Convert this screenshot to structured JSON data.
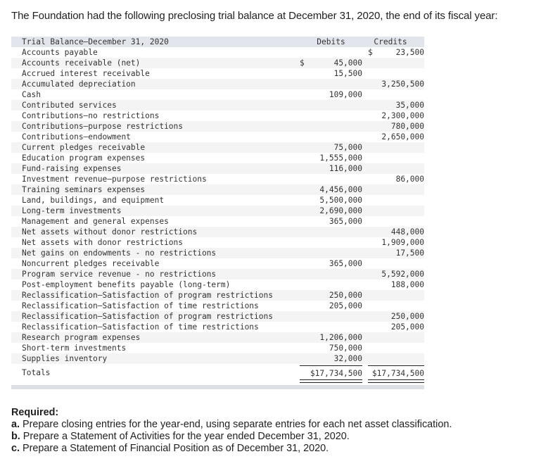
{
  "intro": "The Foundation had the following preclosing trial balance at December 31, 2020, the end of its fiscal year:",
  "table": {
    "title": "Trial Balance—December 31, 2020",
    "debits_header": "Debits",
    "credits_header": "Credits",
    "rows": [
      {
        "name": "Accounts payable",
        "dsign": "",
        "debit": "",
        "csign": "$",
        "credit": "23,500"
      },
      {
        "name": "Accounts receivable (net)",
        "dsign": "$",
        "debit": "45,000",
        "csign": "",
        "credit": ""
      },
      {
        "name": "Accrued interest receivable",
        "dsign": "",
        "debit": "15,500",
        "csign": "",
        "credit": ""
      },
      {
        "name": "Accumulated depreciation",
        "dsign": "",
        "debit": "",
        "csign": "",
        "credit": "3,250,500"
      },
      {
        "name": "Cash",
        "dsign": "",
        "debit": "109,000",
        "csign": "",
        "credit": ""
      },
      {
        "name": "Contributed services",
        "dsign": "",
        "debit": "",
        "csign": "",
        "credit": "35,000"
      },
      {
        "name": "Contributions—no restrictions",
        "dsign": "",
        "debit": "",
        "csign": "",
        "credit": "2,300,000"
      },
      {
        "name": "Contributions—purpose restrictions",
        "dsign": "",
        "debit": "",
        "csign": "",
        "credit": "780,000"
      },
      {
        "name": "Contributions—endowment",
        "dsign": "",
        "debit": "",
        "csign": "",
        "credit": "2,650,000"
      },
      {
        "name": "Current pledges receivable",
        "dsign": "",
        "debit": "75,000",
        "csign": "",
        "credit": ""
      },
      {
        "name": "Education program expenses",
        "dsign": "",
        "debit": "1,555,000",
        "csign": "",
        "credit": ""
      },
      {
        "name": "Fund-raising expenses",
        "dsign": "",
        "debit": "116,000",
        "csign": "",
        "credit": ""
      },
      {
        "name": "Investment revenue—purpose restrictions",
        "dsign": "",
        "debit": "",
        "csign": "",
        "credit": "86,000"
      },
      {
        "name": "Training seminars expenses",
        "dsign": "",
        "debit": "4,456,000",
        "csign": "",
        "credit": ""
      },
      {
        "name": "Land, buildings, and equipment",
        "dsign": "",
        "debit": "5,500,000",
        "csign": "",
        "credit": ""
      },
      {
        "name": "Long-term investments",
        "dsign": "",
        "debit": "2,690,000",
        "csign": "",
        "credit": ""
      },
      {
        "name": "Management and general expenses",
        "dsign": "",
        "debit": "365,000",
        "csign": "",
        "credit": ""
      },
      {
        "name": "Net assets without donor restrictions",
        "dsign": "",
        "debit": "",
        "csign": "",
        "credit": "448,000"
      },
      {
        "name": "Net assets with donor restrictions",
        "dsign": "",
        "debit": "",
        "csign": "",
        "credit": "1,909,000"
      },
      {
        "name": "Net gains on endowments - no restrictions",
        "dsign": "",
        "debit": "",
        "csign": "",
        "credit": "17,500"
      },
      {
        "name": "Noncurrent pledges receivable",
        "dsign": "",
        "debit": "365,000",
        "csign": "",
        "credit": ""
      },
      {
        "name": "Program service revenue - no restrictions",
        "dsign": "",
        "debit": "",
        "csign": "",
        "credit": "5,592,000"
      },
      {
        "name": "Post-employment benefits payable (long-term)",
        "dsign": "",
        "debit": "",
        "csign": "",
        "credit": "188,000"
      },
      {
        "name": "Reclassification—Satisfaction of program restrictions",
        "dsign": "",
        "debit": "250,000",
        "csign": "",
        "credit": ""
      },
      {
        "name": "Reclassification—Satisfaction of time restrictions",
        "dsign": "",
        "debit": "205,000",
        "csign": "",
        "credit": ""
      },
      {
        "name": "Reclassification—Satisfaction of program restrictions",
        "dsign": "",
        "debit": "",
        "csign": "",
        "credit": "250,000"
      },
      {
        "name": "Reclassification—Satisfaction of time restrictions",
        "dsign": "",
        "debit": "",
        "csign": "",
        "credit": "205,000"
      },
      {
        "name": "Research program expenses",
        "dsign": "",
        "debit": "1,206,000",
        "csign": "",
        "credit": ""
      },
      {
        "name": "Short-term investments",
        "dsign": "",
        "debit": "750,000",
        "csign": "",
        "credit": ""
      },
      {
        "name": "Supplies inventory",
        "dsign": "",
        "debit": "32,000",
        "csign": "",
        "credit": ""
      }
    ],
    "totals_label": "Totals",
    "total_debits": "$17,734,500",
    "total_credits": "$17,734,500"
  },
  "required": {
    "heading": "Required:",
    "items": [
      {
        "letter": "a.",
        "text": " Prepare closing entries for the year-end, using separate entries for each net asset classification."
      },
      {
        "letter": "b.",
        "text": " Prepare a Statement of Activities for the year ended December 31, 2020."
      },
      {
        "letter": "c.",
        "text": " Prepare a Statement of Financial Position as of December 31, 2020."
      }
    ]
  }
}
